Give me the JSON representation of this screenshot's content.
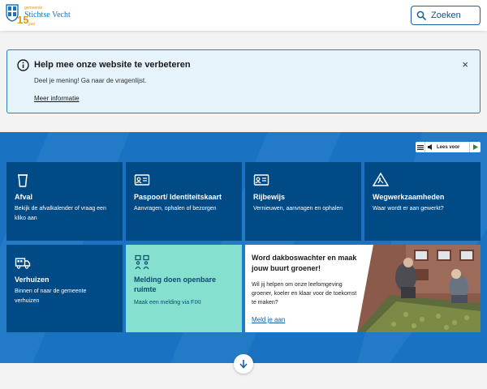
{
  "header": {
    "logo": {
      "small_text": "gemeente",
      "name": "Stichtse Vecht",
      "years": "15",
      "years_label": "jaar"
    },
    "search_label": "Zoeken",
    "accent_color": "#1f5ea1"
  },
  "notice": {
    "title": "Help mee onze website te verbeteren",
    "body": "Deel je mening! Ga naar de vragenlijst.",
    "link": "Meer informatie",
    "close": "×"
  },
  "readspeaker": {
    "label": "Lees voor"
  },
  "tiles": [
    {
      "title": "Afval",
      "description": "Bekijk de afvalkalender of vraag een kliko aan",
      "icon": "trash-bin-icon"
    },
    {
      "title": "Paspoort/ Identiteitskaart",
      "description": "Aanvragen, ophalen of bezorgen",
      "icon": "id-card-icon"
    },
    {
      "title": "Rijbewijs",
      "description": "Vernieuwen, aanvragen en ophalen",
      "icon": "license-card-icon"
    },
    {
      "title": "Wegwerkzaamheden",
      "description": "Waar wordt er aan gewerkt?",
      "icon": "road-works-icon"
    },
    {
      "title": "Verhuizen",
      "description": "Binnen of naar de gemeente verhuizen",
      "icon": "moving-truck-icon"
    },
    {
      "title": "Melding doen openbare ruimte",
      "description": "Maak een melding via FIXI",
      "icon": "people-report-icon"
    }
  ],
  "promo": {
    "title": "Word dakboswachter en maak jouw buurt groener!",
    "body": "Wil jij helpen om onze leefomgeving groener, koeler en klaar voor de toekomst te maken?",
    "link": "Meld je aan"
  },
  "colors": {
    "tile_blue": "#004a86",
    "tile_teal": "#86e0cf",
    "section_blue": "#1a73c2"
  }
}
